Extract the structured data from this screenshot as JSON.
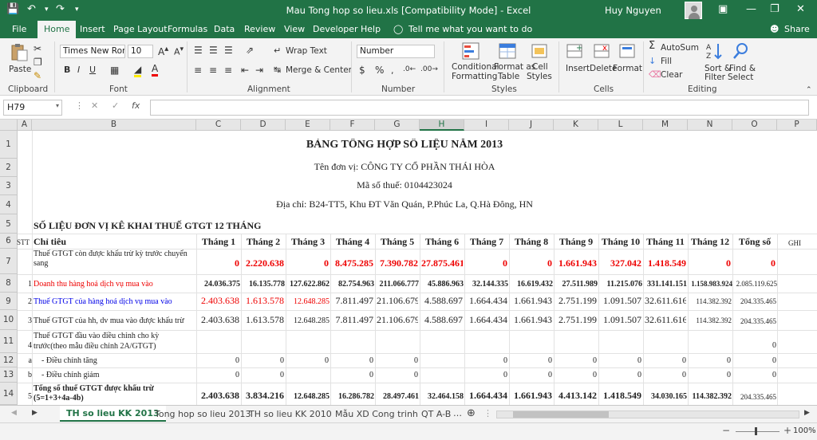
{
  "window": {
    "title": "Mau Tong hop so lieu.xls  [Compatibility Mode]  -  Excel",
    "user": "Huy Nguyen"
  },
  "menu": {
    "tabs": [
      "File",
      "Home",
      "Insert",
      "Page Layout",
      "Formulas",
      "Data",
      "Review",
      "View",
      "Developer",
      "Help"
    ],
    "tell_me": "Tell me what you want to do",
    "share": "Share"
  },
  "ribbon": {
    "clipboard": {
      "label": "Clipboard",
      "paste": "Paste"
    },
    "font": {
      "label": "Font",
      "font_name": "Times New Roma",
      "font_size": "10"
    },
    "alignment": {
      "label": "Alignment",
      "wrap_text": "Wrap Text",
      "merge": "Merge & Center"
    },
    "number": {
      "label": "Number",
      "format": "Number"
    },
    "styles": {
      "label": "Styles",
      "conditional": "Conditional",
      "conditional2": "Formatting",
      "format_as": "Format as",
      "format_as2": "Table",
      "cell": "Cell",
      "cell2": "Styles"
    },
    "cells": {
      "label": "Cells",
      "insert": "Insert",
      "delete": "Delete",
      "format": "Format"
    },
    "editing": {
      "label": "Editing",
      "autosum": "AutoSum",
      "fill": "Fill",
      "clear": "Clear",
      "sort": "Sort &",
      "sort2": "Filter",
      "find": "Find &",
      "find2": "Select"
    }
  },
  "formula_bar": {
    "name_box": "H79",
    "fx": "fx"
  },
  "columns": [
    "A",
    "B",
    "C",
    "D",
    "E",
    "F",
    "G",
    "H",
    "I",
    "J",
    "K",
    "L",
    "M",
    "N",
    "O",
    "P"
  ],
  "rows": [
    "1",
    "2",
    "3",
    "4",
    "5",
    "6",
    "7",
    "8",
    "9",
    "10",
    "11",
    "12",
    "13",
    "14"
  ],
  "sheet": {
    "title": "BẢNG TỔNG HỢP SỐ LIỆU NĂM 2013",
    "unit": "Tên đơn vị: CÔNG TY CỔ PHẦN THÁI HÒA",
    "tax": "Mã số thuế: 0104423024",
    "address": "Địa chỉ: B24-TT5, Khu ĐT Văn Quán, P.Phúc La, Q.Hà Đông, HN",
    "section": "SỐ LIỆU ĐƠN VỊ KÊ KHAI THUẾ GTGT 12 THÁNG",
    "stt_header": "STT",
    "indicator_header": "Chỉ tiêu",
    "month_headers": [
      "Tháng 1",
      "Tháng 2",
      "Tháng 3",
      "Tháng 4",
      "Tháng 5",
      "Tháng 6",
      "Tháng 7",
      "Tháng 8",
      "Tháng 9",
      "Tháng 10",
      "Tháng 11",
      "Tháng 12",
      "Tổng số"
    ],
    "note_header": "GHI",
    "rows": [
      {
        "stt": "",
        "label": "Thuế GTGT còn được khấu trừ kỳ trước chuyển sang",
        "values": [
          "0",
          "2.220.638",
          "0",
          "8.475.285",
          "7.390.782",
          "27.875.461",
          "0",
          "0",
          "1.661.943",
          "327.042",
          "1.418.549",
          "0",
          "0"
        ]
      },
      {
        "stt": "1",
        "label": "Doanh thu  hàng hoá dịch vụ mua vào",
        "values": [
          "24.036.375",
          "16.135.778",
          "127.622.862",
          "82.754.963",
          "211.066.777",
          "45.886.963",
          "32.144.335",
          "16.619.432",
          "27.511.989",
          "11.215.076",
          "331.141.151",
          "1.158.983.924",
          "2.085.119.625"
        ]
      },
      {
        "stt": "2",
        "label": "Thuế GTGT của hàng hoá dịch vụ mua vào",
        "values": [
          "2.403.638",
          "1.613.578",
          "12.648.285",
          "7.811.497",
          "21.106.679",
          "4.588.697",
          "1.664.434",
          "1.661.943",
          "2.751.199",
          "1.091.507",
          "32.611.616",
          "114.382.392",
          "204.335.465"
        ]
      },
      {
        "stt": "3",
        "label": "Thuế GTGT của hh, dv  mua vào được khấu trừ",
        "values": [
          "2.403.638",
          "1.613.578",
          "12.648.285",
          "7.811.497",
          "21.106.679",
          "4.588.697",
          "1.664.434",
          "1.661.943",
          "2.751.199",
          "1.091.507",
          "32.611.616",
          "114.382.392",
          "204.335.465"
        ]
      },
      {
        "stt": "4",
        "label1": "Thuế GTGT đầu vào điều chỉnh cho kỳ",
        "label2": "trước(theo mẫu điều chỉnh 2A/GTGT)",
        "values": [
          "",
          "",
          "",
          "",
          "",
          "",
          "",
          "",
          "",
          "",
          "",
          "",
          "0"
        ]
      },
      {
        "stt": "a",
        "label": "- Điều chỉnh tăng",
        "values": [
          "0",
          "0",
          "0",
          "0",
          "0",
          "",
          "0",
          "0",
          "0",
          "0",
          "0",
          "0",
          "0"
        ]
      },
      {
        "stt": "b",
        "label": "- Điều chỉnh giảm",
        "values": [
          "0",
          "0",
          "",
          "0",
          "0",
          "",
          "0",
          "0",
          "0",
          "0",
          "0",
          "0",
          "0"
        ]
      },
      {
        "stt": "5",
        "label1": "Tổng số thuế GTGT được khấu trừ",
        "label2": "(5=1+3+4a-4b)",
        "values": [
          "2.403.638",
          "3.834.216",
          "12.648.285",
          "16.286.782",
          "28.497.461",
          "32.464.158",
          "1.664.434",
          "1.661.943",
          "4.413.142",
          "1.418.549",
          "34.030.165",
          "114.382.392",
          "204.335.465"
        ]
      }
    ]
  },
  "sheet_tabs": [
    "TH so lieu KK 2013",
    "Tong hop so lieu 2013",
    "TH so lieu KK 2010",
    "Mẫu XD Cong trinh",
    "QT A-B"
  ],
  "status": {
    "zoom": "100%"
  }
}
